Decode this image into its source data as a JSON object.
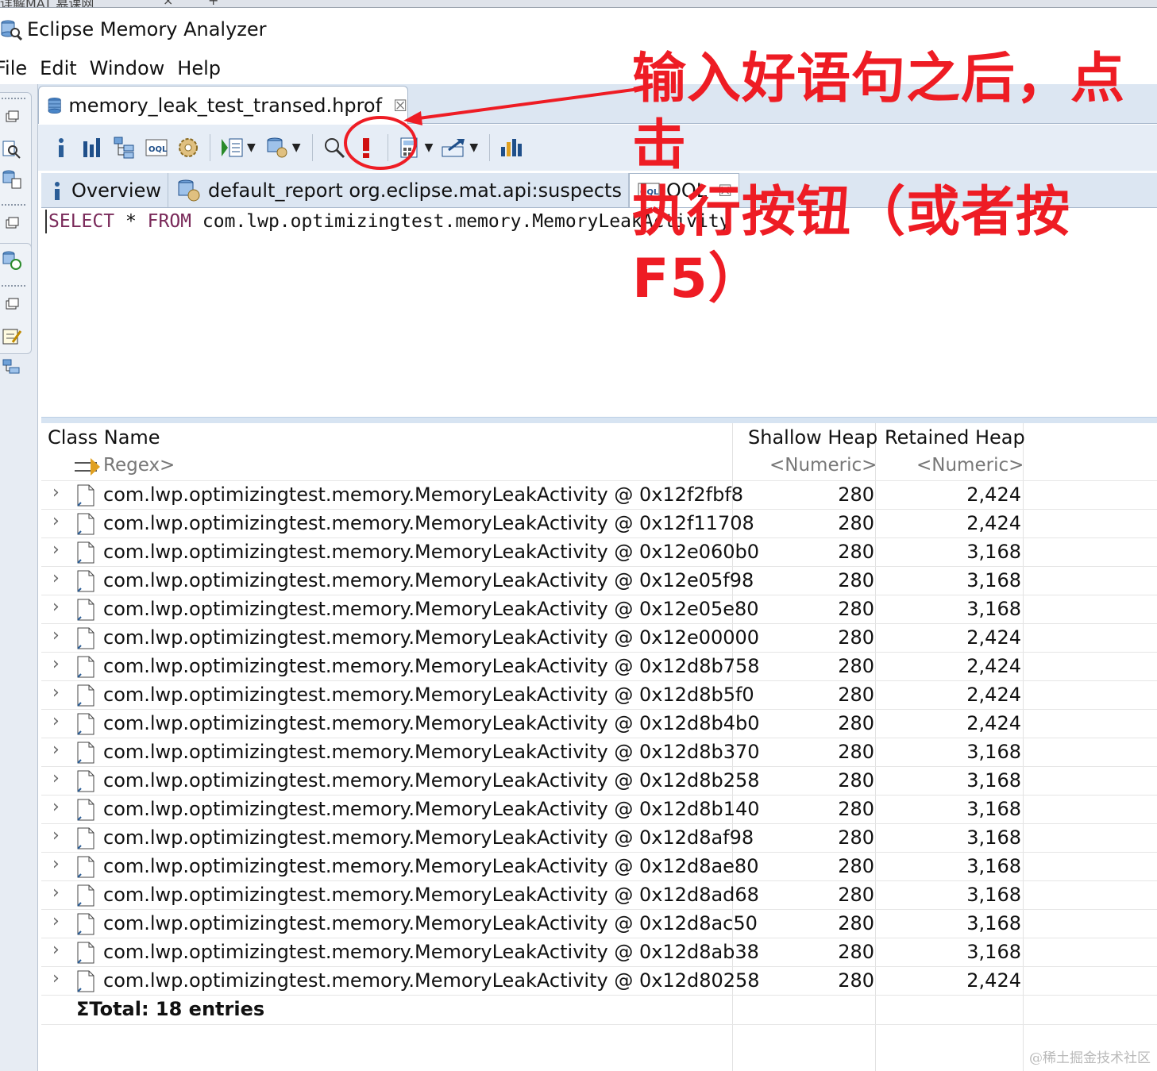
{
  "browser_tab": {
    "title": "详解MAT 慕课网",
    "close": "×",
    "new": "+"
  },
  "window": {
    "title": "Eclipse Memory Analyzer"
  },
  "menu": [
    {
      "label": "File"
    },
    {
      "label": "Edit"
    },
    {
      "label": "Window"
    },
    {
      "label": "Help"
    }
  ],
  "editor_tab": {
    "label": "memory_leak_test_transed.hprof"
  },
  "content_tabs": [
    {
      "label": "Overview",
      "icon": "info-icon"
    },
    {
      "label": "default_report  org.eclipse.mat.api:suspects",
      "icon": "report-icon"
    },
    {
      "label": "OQL",
      "icon": "oql-icon"
    }
  ],
  "query": {
    "select": "SELECT",
    "star": " * ",
    "from": "FROM",
    "rest": " com.lwp.optimizingtest.memory.MemoryLeakActivity"
  },
  "table": {
    "headers": {
      "class_name": "Class Name",
      "shallow": "Shallow Heap",
      "retained": "Retained Heap"
    },
    "filters": {
      "class_name": "Regex>",
      "shallow": "<Numeric>",
      "retained": "<Numeric>"
    },
    "rows": [
      {
        "name": "com.lwp.optimizingtest.memory.MemoryLeakActivity @ 0x12f2fbf8",
        "shallow": "280",
        "retained": "2,424"
      },
      {
        "name": "com.lwp.optimizingtest.memory.MemoryLeakActivity @ 0x12f11708",
        "shallow": "280",
        "retained": "2,424"
      },
      {
        "name": "com.lwp.optimizingtest.memory.MemoryLeakActivity @ 0x12e060b0",
        "shallow": "280",
        "retained": "3,168"
      },
      {
        "name": "com.lwp.optimizingtest.memory.MemoryLeakActivity @ 0x12e05f98",
        "shallow": "280",
        "retained": "3,168"
      },
      {
        "name": "com.lwp.optimizingtest.memory.MemoryLeakActivity @ 0x12e05e80",
        "shallow": "280",
        "retained": "3,168"
      },
      {
        "name": "com.lwp.optimizingtest.memory.MemoryLeakActivity @ 0x12e00000",
        "shallow": "280",
        "retained": "2,424"
      },
      {
        "name": "com.lwp.optimizingtest.memory.MemoryLeakActivity @ 0x12d8b758",
        "shallow": "280",
        "retained": "2,424"
      },
      {
        "name": "com.lwp.optimizingtest.memory.MemoryLeakActivity @ 0x12d8b5f0",
        "shallow": "280",
        "retained": "2,424"
      },
      {
        "name": "com.lwp.optimizingtest.memory.MemoryLeakActivity @ 0x12d8b4b0",
        "shallow": "280",
        "retained": "2,424"
      },
      {
        "name": "com.lwp.optimizingtest.memory.MemoryLeakActivity @ 0x12d8b370",
        "shallow": "280",
        "retained": "3,168"
      },
      {
        "name": "com.lwp.optimizingtest.memory.MemoryLeakActivity @ 0x12d8b258",
        "shallow": "280",
        "retained": "3,168"
      },
      {
        "name": "com.lwp.optimizingtest.memory.MemoryLeakActivity @ 0x12d8b140",
        "shallow": "280",
        "retained": "3,168"
      },
      {
        "name": "com.lwp.optimizingtest.memory.MemoryLeakActivity @ 0x12d8af98",
        "shallow": "280",
        "retained": "3,168"
      },
      {
        "name": "com.lwp.optimizingtest.memory.MemoryLeakActivity @ 0x12d8ae80",
        "shallow": "280",
        "retained": "3,168"
      },
      {
        "name": "com.lwp.optimizingtest.memory.MemoryLeakActivity @ 0x12d8ad68",
        "shallow": "280",
        "retained": "3,168"
      },
      {
        "name": "com.lwp.optimizingtest.memory.MemoryLeakActivity @ 0x12d8ac50",
        "shallow": "280",
        "retained": "3,168"
      },
      {
        "name": "com.lwp.optimizingtest.memory.MemoryLeakActivity @ 0x12d8ab38",
        "shallow": "280",
        "retained": "3,168"
      },
      {
        "name": "com.lwp.optimizingtest.memory.MemoryLeakActivity @ 0x12d80258",
        "shallow": "280",
        "retained": "2,424"
      }
    ],
    "total": "Total: 18 entries"
  },
  "annotation": {
    "line1": "输入好语句之后，点击",
    "line2": "执行按钮（或者按F5）",
    "color": "#ee1c24"
  },
  "watermark": "@稀土掘金技术社区",
  "toolbar_icons": [
    "info-icon",
    "histogram-icon",
    "dominator-tree-icon",
    "oql-icon",
    "thread-overview-icon",
    "heap-dump-overview-icon",
    "query-browser-icon",
    "search-icon",
    "execute-query-icon",
    "calculate-heap-icon",
    "export-icon",
    "compare-icon"
  ]
}
